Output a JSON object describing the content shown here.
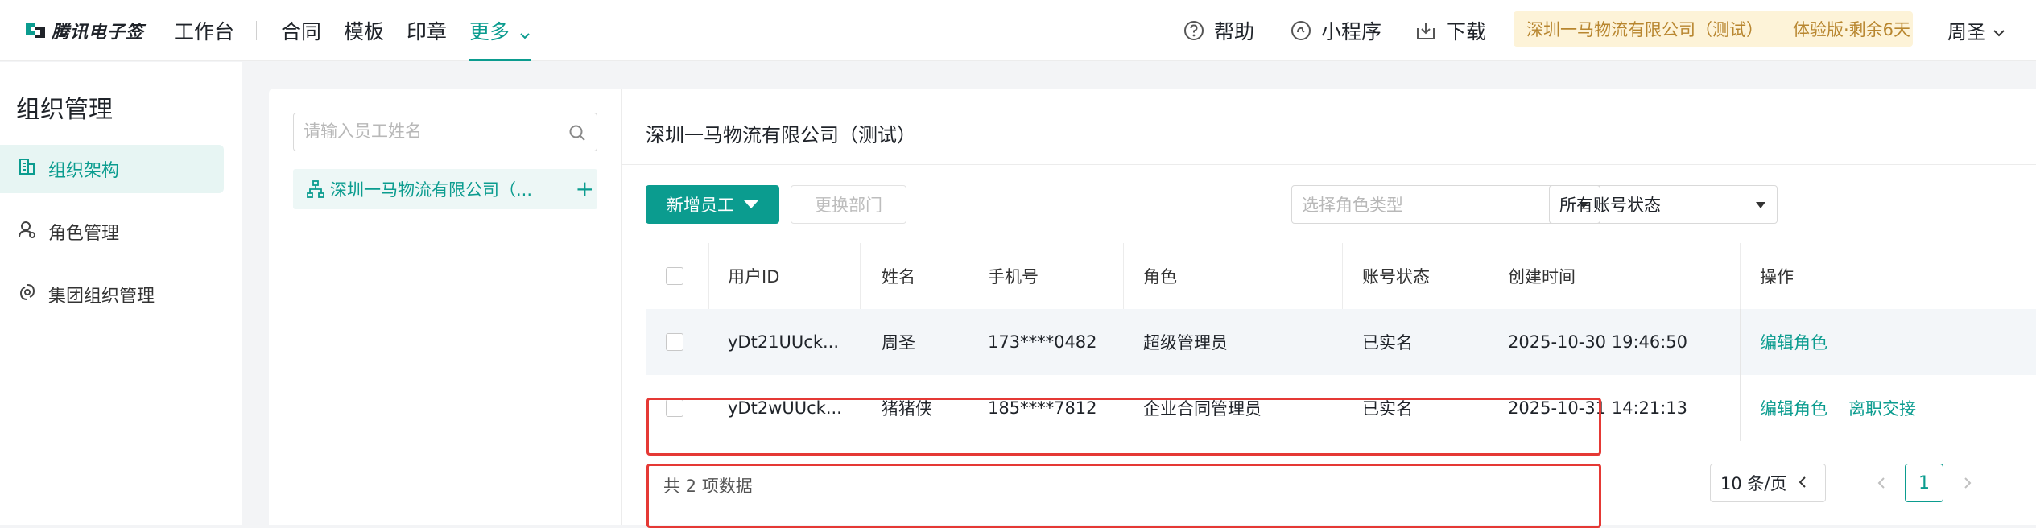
{
  "brand": {
    "name": "腾讯电子签"
  },
  "nav": {
    "workbench": "工作台",
    "items": [
      "合同",
      "模板",
      "印章",
      "更多"
    ]
  },
  "topright": {
    "help": "帮助",
    "miniapp": "小程序",
    "download": "下载",
    "company": "深圳一马物流有限公司（测试）",
    "plan": "体验版·剩余6天",
    "user": "周圣"
  },
  "sidebar": {
    "title": "组织管理",
    "items": [
      {
        "label": "组织架构",
        "icon": "org-structure-icon"
      },
      {
        "label": "角色管理",
        "icon": "role-icon"
      },
      {
        "label": "集团组织管理",
        "icon": "group-org-icon"
      }
    ]
  },
  "tree": {
    "search_placeholder": "请输入员工姓名",
    "node": "深圳一马物流有限公司（...",
    "add": "+"
  },
  "main": {
    "org_title": "深圳一马物流有限公司（测试）",
    "add_employee": "新增员工",
    "change_dept": "更换部门",
    "role_type_placeholder": "选择角色类型",
    "account_status": "所有账号状态"
  },
  "table": {
    "columns": [
      "用户ID",
      "姓名",
      "手机号",
      "角色",
      "账号状态",
      "创建时间",
      "操作"
    ],
    "rows": [
      {
        "id": "yDt21UUck...",
        "name": "周圣",
        "phone": "173****0482",
        "role": "超级管理员",
        "status": "已实名",
        "created": "2025-10-30 19:46:50",
        "actions": [
          "编辑角色"
        ]
      },
      {
        "id": "yDt2wUUck...",
        "name": "猪猪侠",
        "phone": "185****7812",
        "role": "企业合同管理员",
        "status": "已实名",
        "created": "2025-10-31 14:21:13",
        "actions": [
          "编辑角色",
          "离职交接"
        ]
      }
    ]
  },
  "footer": {
    "total": "共 2 项数据",
    "page_size": "10 条/页",
    "current_page": "1"
  },
  "colors": {
    "accent": "#0b9c8f",
    "highlight": "#e53935",
    "plan_bg": "#fdf3d8",
    "plan_text": "#b8862f"
  }
}
